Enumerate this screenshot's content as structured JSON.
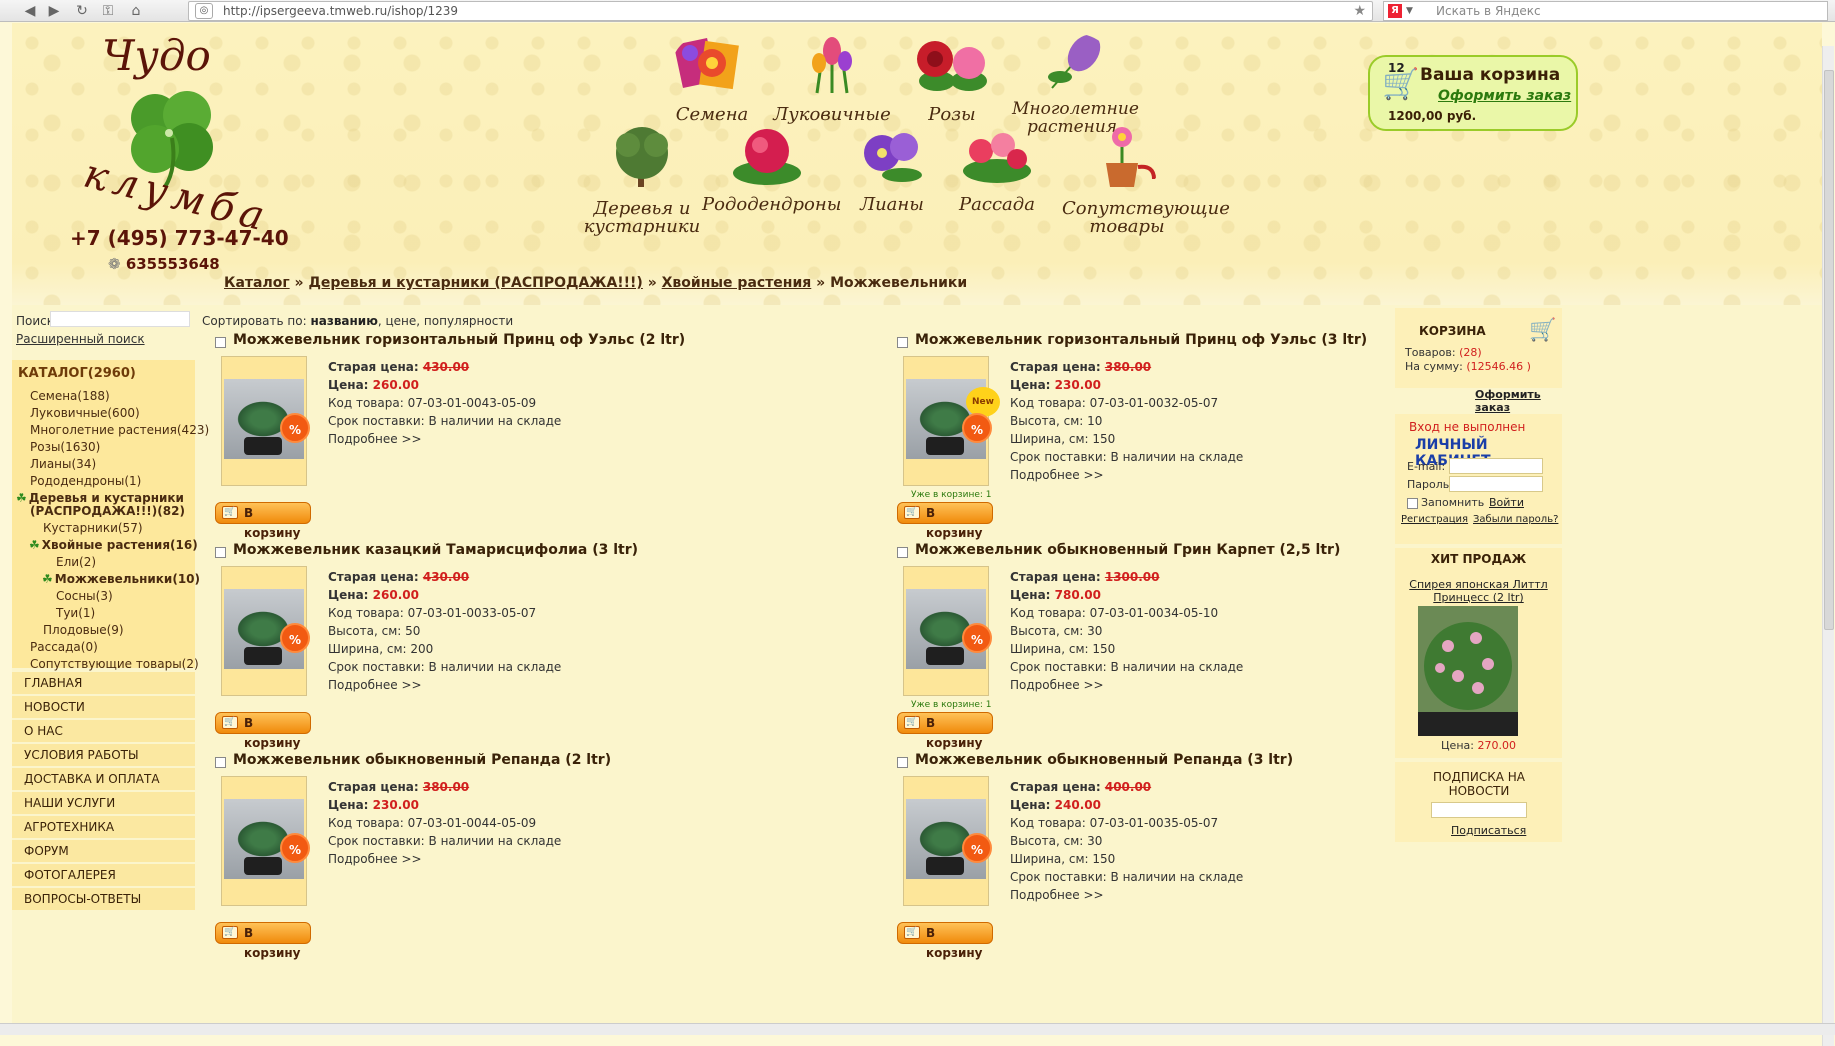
{
  "browser": {
    "url": "http://ipsergeeva.tmweb.ru/ishop/1239",
    "search_placeholder": "Искать в Яндекс",
    "yandex_letter": "Я"
  },
  "header": {
    "logo_top": "Чудо",
    "logo_bottom": "клумба",
    "phone": "+7 (495) 773-47-40",
    "icq": "635553648"
  },
  "categories": [
    {
      "label": "Семена"
    },
    {
      "label": "Луковичные"
    },
    {
      "label": "Розы"
    },
    {
      "label": "Многолетние растения"
    },
    {
      "label": "Деревья и кустарники"
    },
    {
      "label": "Рододендроны"
    },
    {
      "label": "Лианы"
    },
    {
      "label": "Рассада"
    },
    {
      "label": "Сопутствующие товары"
    }
  ],
  "cart_top": {
    "count": "12",
    "title": "Ваша корзина",
    "order": "Оформить заказ",
    "sum": "1200,00 руб."
  },
  "breadcrumb": {
    "items": [
      "Каталог",
      "Деревья и кустарники (РАСПРОДАЖА!!!)",
      "Хвойные растения"
    ],
    "current": "Можжевельники",
    "sep": "»"
  },
  "left": {
    "search_label": "Поиск",
    "advanced": "Расширенный поиск",
    "catalog_head": "КАТАЛОГ(2960)",
    "catalog": [
      "Семена(188)",
      "Луковичные(600)",
      "Многолетние растения(423)",
      "Розы(1630)",
      "Лианы(34)",
      "Рододендроны(1)",
      "Деревья и кустарники",
      "(РАСПРОДАЖА!!!)(82)",
      "Кустарники(57)",
      "Хвойные растения(16)",
      "Ели(2)",
      "Можжевельники(10)",
      "Сосны(3)",
      "Туи(1)",
      "Плодовые(9)",
      "Рассада(0)",
      "Сопутствующие товары(2)"
    ],
    "menu": [
      "ГЛАВНАЯ",
      "НОВОСТИ",
      "О НАС",
      "УСЛОВИЯ РАБОТЫ",
      "ДОСТАВКА И ОПЛАТА",
      "НАШИ УСЛУГИ",
      "АГРОТЕХНИКА",
      "ФОРУМ",
      "ФОТОГАЛЕРЕЯ",
      "ВОПРОСЫ-ОТВЕТЫ"
    ]
  },
  "sort": {
    "label": "Сортировать по:",
    "active": "названию",
    "others": ", цене, популярности"
  },
  "labels": {
    "old": "Старая цена:",
    "price": "Цена:",
    "code": "Код товара:",
    "height": "Высота, см:",
    "width": "Ширина, см:",
    "delivery": "Срок поставки:",
    "more": "Подробнее >>",
    "buy": "В корзину",
    "in_cart": "Уже в корзине: 1",
    "new": "New",
    "pct": "%"
  },
  "products": [
    {
      "title": "Можжевельник горизонтальный Принц оф Уэльс (2 ltr)",
      "old": "430.00",
      "price": "260.00",
      "code": "07-03-01-0043-05-09",
      "height": "",
      "width": "",
      "delivery": "В наличии на складе",
      "in_cart": false,
      "new": false
    },
    {
      "title": "Можжевельник горизонтальный Принц оф Уэльс (3 ltr)",
      "old": "380.00",
      "price": "230.00",
      "code": "07-03-01-0032-05-07",
      "height": "10",
      "width": "150",
      "delivery": "В наличии на складе",
      "in_cart": true,
      "new": true
    },
    {
      "title": "Можжевельник казацкий Тамарисцифолиа (3 ltr)",
      "old": "430.00",
      "price": "260.00",
      "code": "07-03-01-0033-05-07",
      "height": "50",
      "width": "200",
      "delivery": "В наличии на складе",
      "in_cart": false,
      "new": false
    },
    {
      "title": "Можжевельник обыкновенный Грин Карпет (2,5 ltr)",
      "old": "1300.00",
      "price": "780.00",
      "code": "07-03-01-0034-05-10",
      "height": "30",
      "width": "150",
      "delivery": "В наличии на складе",
      "in_cart": true,
      "new": false
    },
    {
      "title": "Можжевельник обыкновенный Репанда (2 ltr)",
      "old": "380.00",
      "price": "230.00",
      "code": "07-03-01-0044-05-09",
      "height": "",
      "width": "",
      "delivery": "В наличии на складе",
      "in_cart": false,
      "new": false
    },
    {
      "title": "Можжевельник обыкновенный Репанда (3 ltr)",
      "old": "400.00",
      "price": "240.00",
      "code": "07-03-01-0035-05-07",
      "height": "30",
      "width": "150",
      "delivery": "В наличии на складе",
      "in_cart": false,
      "new": false
    }
  ],
  "right": {
    "cart_title": "КОРЗИНА",
    "items_label": "Товаров:",
    "items_value": "(28)",
    "sum_label": "На сумму:",
    "sum_value": "(12546.46 )",
    "order": "Оформить заказ",
    "not_logged": "Вход не выполнен",
    "cabinet": "ЛИЧНЫЙ КАБИНЕТ",
    "email_label": "E-mail:",
    "password_label": "Пароль:",
    "remember": "Запомнить",
    "login": "Войти",
    "register": "Регистрация",
    "forgot": "Забыли пароль?",
    "hit_title": "ХИТ ПРОДАЖ",
    "hit_name": "Спирея японская Литтл Принцесс (2 ltr)",
    "hit_price_label": "Цена:",
    "hit_price": "270.00",
    "subscribe_title": "ПОДПИСКА НА НОВОСТИ",
    "subscribe": "Подписаться"
  }
}
